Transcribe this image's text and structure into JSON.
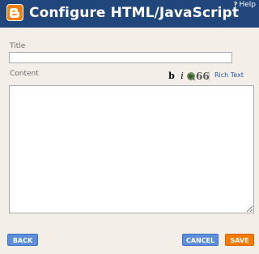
{
  "header": {
    "title": "Configure HTML/JavaScript",
    "help_label": "Help",
    "help_glyph": "?"
  },
  "form": {
    "title_label": "Title",
    "title_value": "",
    "content_label": "Content",
    "content_value": ""
  },
  "toolbar": {
    "bold_glyph": "b",
    "italic_glyph": "i",
    "link_icon": "link-icon",
    "quote_glyph": "66",
    "rich_text_label": "Rich Text"
  },
  "buttons": {
    "back": "BACK",
    "cancel": "CANCEL",
    "save": "SAVE"
  },
  "colors": {
    "header_bg": "#20467b",
    "panel_bg": "#f3eee7",
    "blue_button": "#5b8fdb",
    "orange_button": "#f57b00",
    "link_blue": "#2a55a5"
  }
}
